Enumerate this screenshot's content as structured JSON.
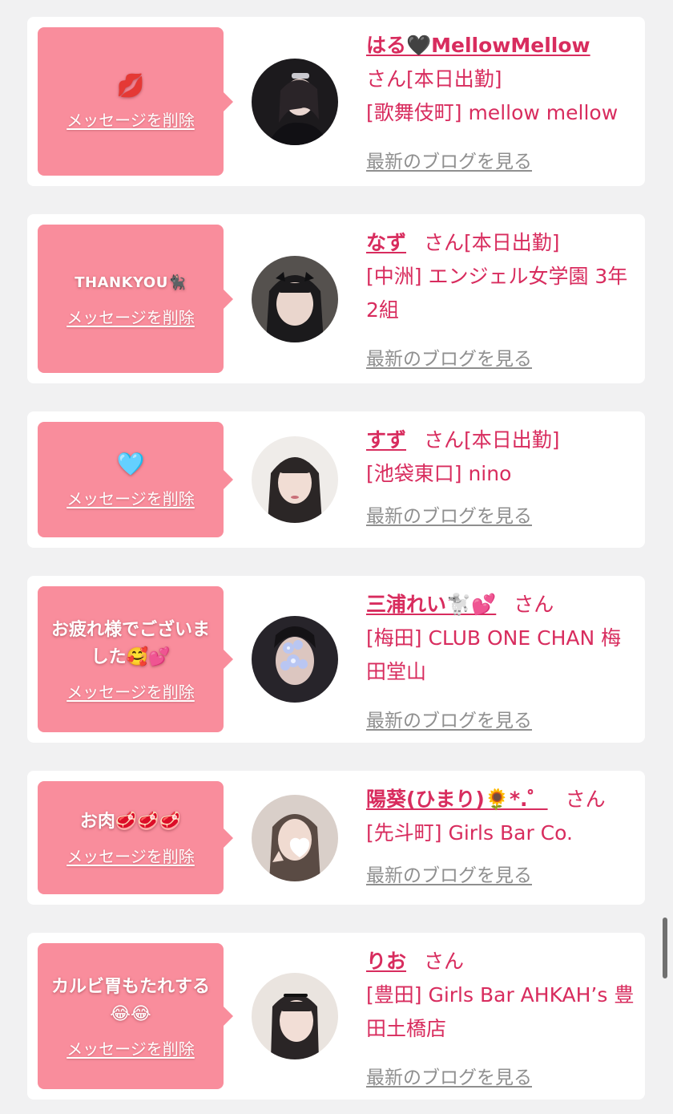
{
  "messages": [
    {
      "message": "💋",
      "delete_label": "メッセージを削除",
      "name": "はる🖤MellowMellow",
      "honorific": "さん",
      "status": "[本日出勤]",
      "shop": "[歌舞伎町] mellow mellow",
      "blog_label": "最新のブログを見る",
      "avatar_icon": "profile-photo"
    },
    {
      "message": "THANKYOU🐈‍⬛",
      "delete_label": "メッセージを削除",
      "name": "なず",
      "honorific": "さん",
      "status": "[本日出勤]",
      "shop": "[中洲] エンジェル女学園 3年2組",
      "blog_label": "最新のブログを見る",
      "avatar_icon": "profile-photo"
    },
    {
      "message": "🩵",
      "delete_label": "メッセージを削除",
      "name": "すず",
      "honorific": "さん",
      "status": "[本日出勤]",
      "shop": "[池袋東口] nino",
      "blog_label": "最新のブログを見る",
      "avatar_icon": "profile-photo"
    },
    {
      "message": "お疲れ様でございました🥰💕",
      "delete_label": "メッセージを削除",
      "name": "三浦れい🐩💕",
      "honorific": "さん",
      "status": "",
      "shop": "[梅田] CLUB ONE CHAN 梅田堂山",
      "blog_label": "最新のブログを見る",
      "avatar_icon": "profile-photo"
    },
    {
      "message": "お肉🥩🥩🥩",
      "delete_label": "メッセージを削除",
      "name": "陽葵(ひまり)🌻*.゜",
      "honorific": "さん",
      "status": "",
      "shop": "[先斗町] Girls Bar Co.",
      "blog_label": "最新のブログを見る",
      "avatar_icon": "profile-photo"
    },
    {
      "message": "カルビ胃もたれする😂😂",
      "delete_label": "メッセージを削除",
      "name": "りお",
      "honorific": "さん",
      "status": "",
      "shop": "[豊田] Girls Bar AHKAH’s 豊田土橋店",
      "blog_label": "最新のブログを見る",
      "avatar_icon": "profile-photo"
    }
  ],
  "colors": {
    "background": "#f1f1f2",
    "bubble": "#f98d9c",
    "accent": "#d82c5e",
    "blog_link": "#8f8f8f"
  }
}
